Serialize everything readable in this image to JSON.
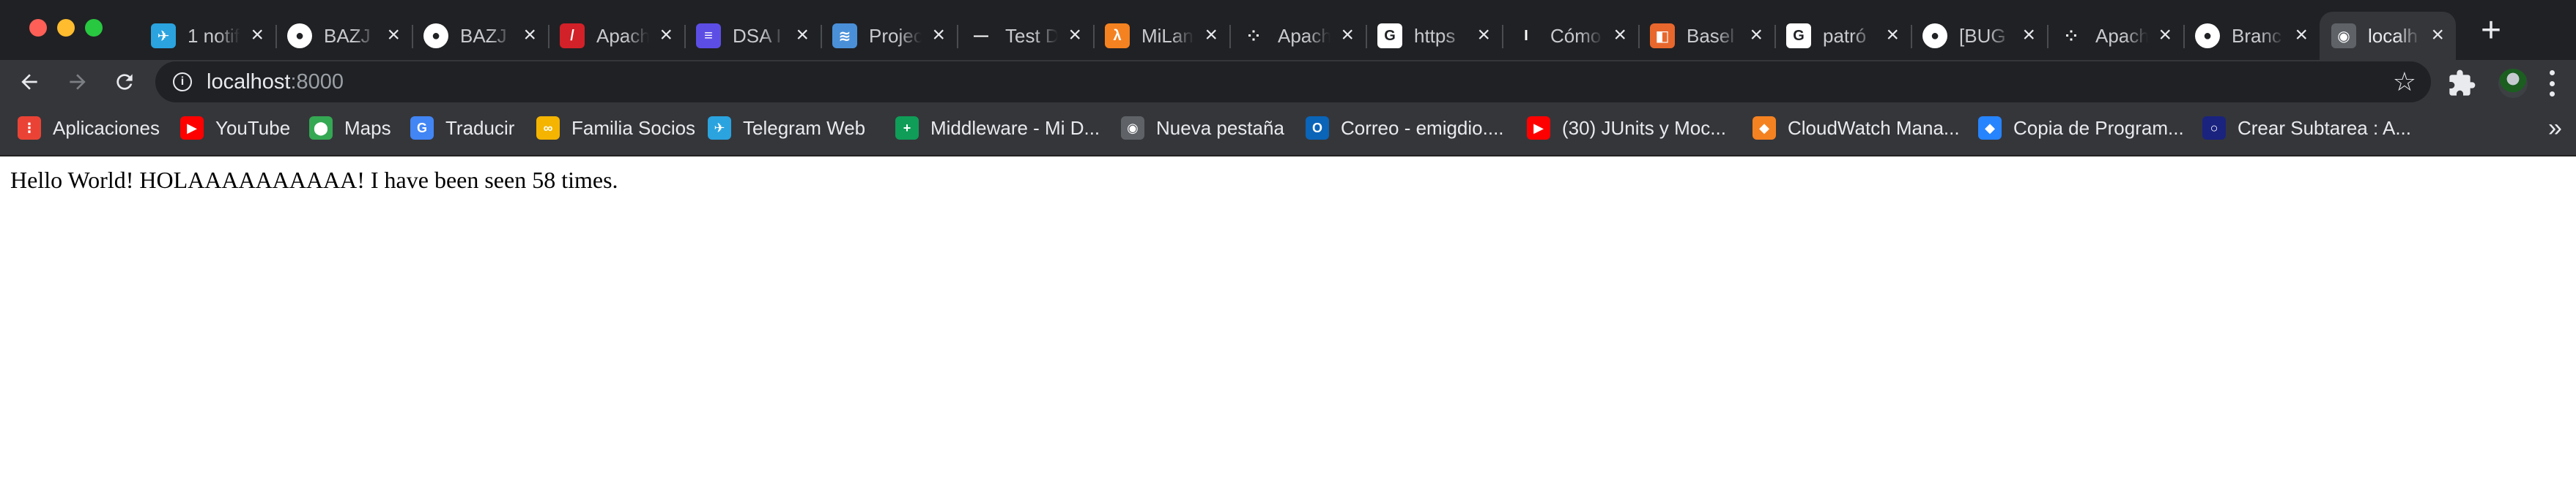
{
  "window": {
    "traffic_lights": [
      "close",
      "minimize",
      "maximize"
    ]
  },
  "tabs": [
    {
      "title": "1 notif",
      "icon": "telegram-icon",
      "color": "#2aa3df",
      "glyph": "✈"
    },
    {
      "title": "BAZJ",
      "icon": "github-icon",
      "color": "#ffffff",
      "glyph": "●"
    },
    {
      "title": "BAZJ",
      "icon": "github-icon",
      "color": "#ffffff",
      "glyph": "●"
    },
    {
      "title": "Apach",
      "icon": "apache-feather-icon",
      "color": "#d22128",
      "glyph": "/"
    },
    {
      "title": "DSA I",
      "icon": "list-icon",
      "color": "#5c4ee5",
      "glyph": "≡"
    },
    {
      "title": "Projec",
      "icon": "wave-icon",
      "color": "#4a90d9",
      "glyph": "≋"
    },
    {
      "title": "Test D",
      "icon": "dash-icon",
      "color": "#202124",
      "glyph": "—"
    },
    {
      "title": "MiLan",
      "icon": "lambda-icon",
      "color": "#f58220",
      "glyph": "λ"
    },
    {
      "title": "Apach",
      "icon": "kafka-icon",
      "color": "#202124",
      "glyph": "⁘"
    },
    {
      "title": "https",
      "icon": "google-icon",
      "color": "#ffffff",
      "glyph": "G"
    },
    {
      "title": "Cómo",
      "icon": "medium-icon",
      "color": "#202124",
      "glyph": "I"
    },
    {
      "title": "Basel",
      "icon": "bracket-icon",
      "color": "#e8672d",
      "glyph": "◧"
    },
    {
      "title": "patró",
      "icon": "google-icon",
      "color": "#ffffff",
      "glyph": "G"
    },
    {
      "title": "[BUG",
      "icon": "github-icon",
      "color": "#ffffff",
      "glyph": "●"
    },
    {
      "title": "Apach",
      "icon": "kafka-icon",
      "color": "#202124",
      "glyph": "⁘"
    },
    {
      "title": "Branc",
      "icon": "github-icon",
      "color": "#ffffff",
      "glyph": "●"
    },
    {
      "title": "localh",
      "icon": "globe-icon",
      "color": "#5f6368",
      "glyph": "◉",
      "active": true
    }
  ],
  "tab_close_glyph": "×",
  "new_tab_glyph": "+",
  "toolbar": {
    "back_glyph": "←",
    "forward_glyph": "→",
    "reload_glyph": "↻",
    "info_glyph": "i",
    "url_host": "localhost",
    "url_port": ":8000",
    "star_glyph": "☆"
  },
  "bookmarks": [
    {
      "label": "Aplicaciones",
      "icon": "apps-grid-icon",
      "color": "#ea4335",
      "glyph": "⋮"
    },
    {
      "label": "YouTube",
      "icon": "youtube-icon",
      "color": "#ff0000",
      "glyph": "▶"
    },
    {
      "label": "Maps",
      "icon": "maps-pin-icon",
      "color": "#34a853",
      "glyph": "⬤"
    },
    {
      "label": "Traducir",
      "icon": "translate-icon",
      "color": "#4285f4",
      "glyph": "G"
    },
    {
      "label": "Familia Socios",
      "icon": "familia-icon",
      "color": "#f4b400",
      "glyph": "∞"
    },
    {
      "label": "Telegram Web",
      "icon": "telegram-icon",
      "color": "#2aa3df",
      "glyph": "✈"
    },
    {
      "label": "Middleware - Mi D...",
      "icon": "sheets-icon",
      "color": "#0f9d58",
      "glyph": "+"
    },
    {
      "label": "Nueva pestaña",
      "icon": "globe-icon",
      "color": "#5f6368",
      "glyph": "◉"
    },
    {
      "label": "Correo - emigdio....",
      "icon": "outlook-icon",
      "color": "#0a64b8",
      "glyph": "O"
    },
    {
      "label": "(30) JUnits y Moc...",
      "icon": "youtube-icon",
      "color": "#ff0000",
      "glyph": "▶"
    },
    {
      "label": "CloudWatch Mana...",
      "icon": "aws-cube-icon",
      "color": "#f58220",
      "glyph": "◆"
    },
    {
      "label": "Copia de Program...",
      "icon": "jira-icon",
      "color": "#2684ff",
      "glyph": "◆"
    },
    {
      "label": "Crear Subtarea : A...",
      "icon": "circle-logo-icon",
      "color": "#1a237e",
      "glyph": "○"
    }
  ],
  "bookmarks_more_glyph": "»",
  "page": {
    "content": "Hello World! HOLAAAAAAAAAA! I have been seen 58 times."
  }
}
